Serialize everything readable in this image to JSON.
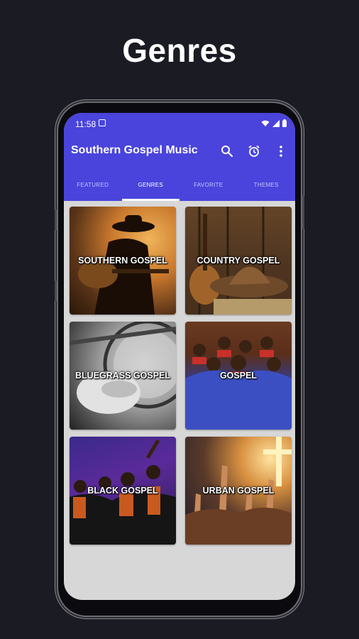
{
  "headline": "Genres",
  "status_bar": {
    "time": "11:58"
  },
  "app_bar": {
    "title": "Southern Gospel Music"
  },
  "tabs": [
    {
      "label": "FEATURED"
    },
    {
      "label": "GENRES"
    },
    {
      "label": "FAVORITE"
    },
    {
      "label": "THEMES"
    }
  ],
  "active_tab": "GENRES",
  "genres": [
    {
      "label": "SOUTHERN GOSPEL"
    },
    {
      "label": "COUNTRY GOSPEL"
    },
    {
      "label": "BLUEGRASS GOSPEL"
    },
    {
      "label": "GOSPEL"
    },
    {
      "label": "BLACK GOSPEL"
    },
    {
      "label": "URBAN GOSPEL"
    }
  ],
  "colors": {
    "accent": "#4a44dc",
    "background": "#1b1b23",
    "grid_bg": "#d7d7d7"
  },
  "icons": [
    "image-icon",
    "wifi-icon",
    "signal-icon",
    "battery-icon",
    "search-icon",
    "alarm-icon",
    "more-vert-icon"
  ]
}
